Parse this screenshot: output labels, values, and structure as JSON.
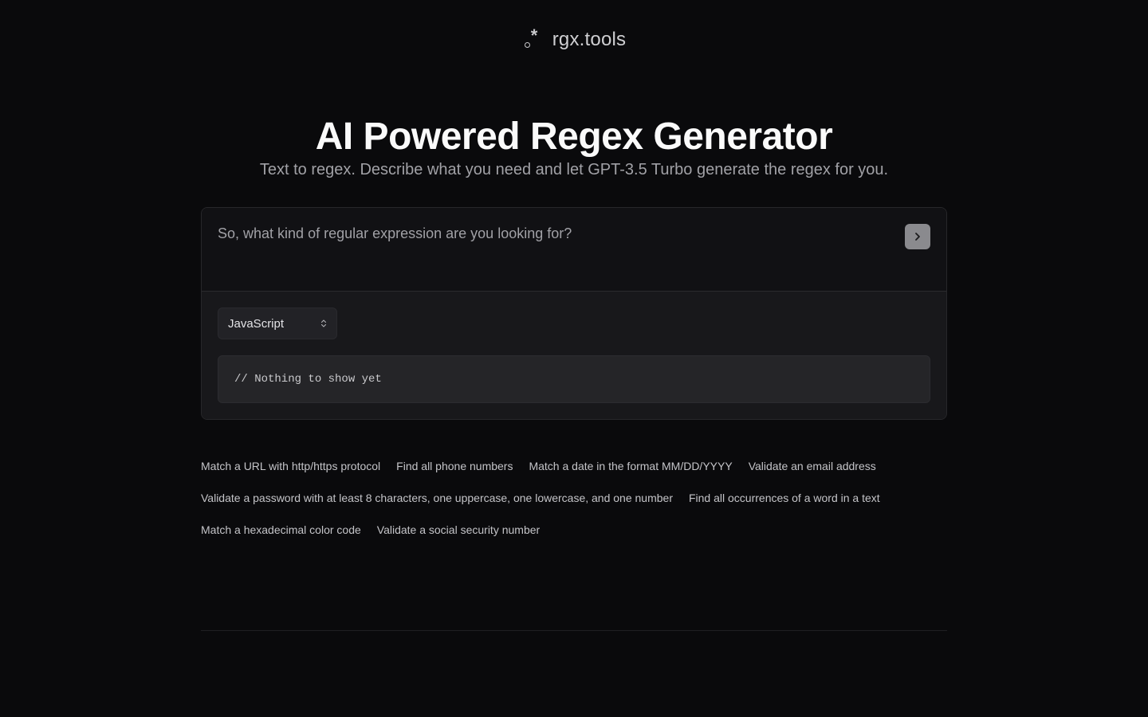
{
  "header": {
    "logo_icon": "regex-dot-star-icon",
    "brand": "rgx.tools"
  },
  "hero": {
    "title": "AI Powered Regex Generator",
    "subtitle": "Text to regex. Describe what you need and let GPT-3.5 Turbo generate the regex for you."
  },
  "prompt": {
    "placeholder": "So, what kind of regular expression are you looking for?",
    "value": "",
    "submit_icon": "chevron-right-icon"
  },
  "output": {
    "language": "JavaScript",
    "language_icon": "chevron-up-down-icon",
    "code": "// Nothing to show yet"
  },
  "examples": [
    "Match a URL with http/https protocol",
    "Find all phone numbers",
    "Match a date in the format MM/DD/YYYY",
    "Validate an email address",
    "Validate a password with at least 8 characters, one uppercase, one lowercase, and one number",
    "Find all occurrences of a word in a text",
    "Match a hexadecimal color code",
    "Validate a social security number"
  ],
  "colors": {
    "background": "#0a0a0c",
    "card": "#131316",
    "submit_button": "#8a8a8e"
  }
}
